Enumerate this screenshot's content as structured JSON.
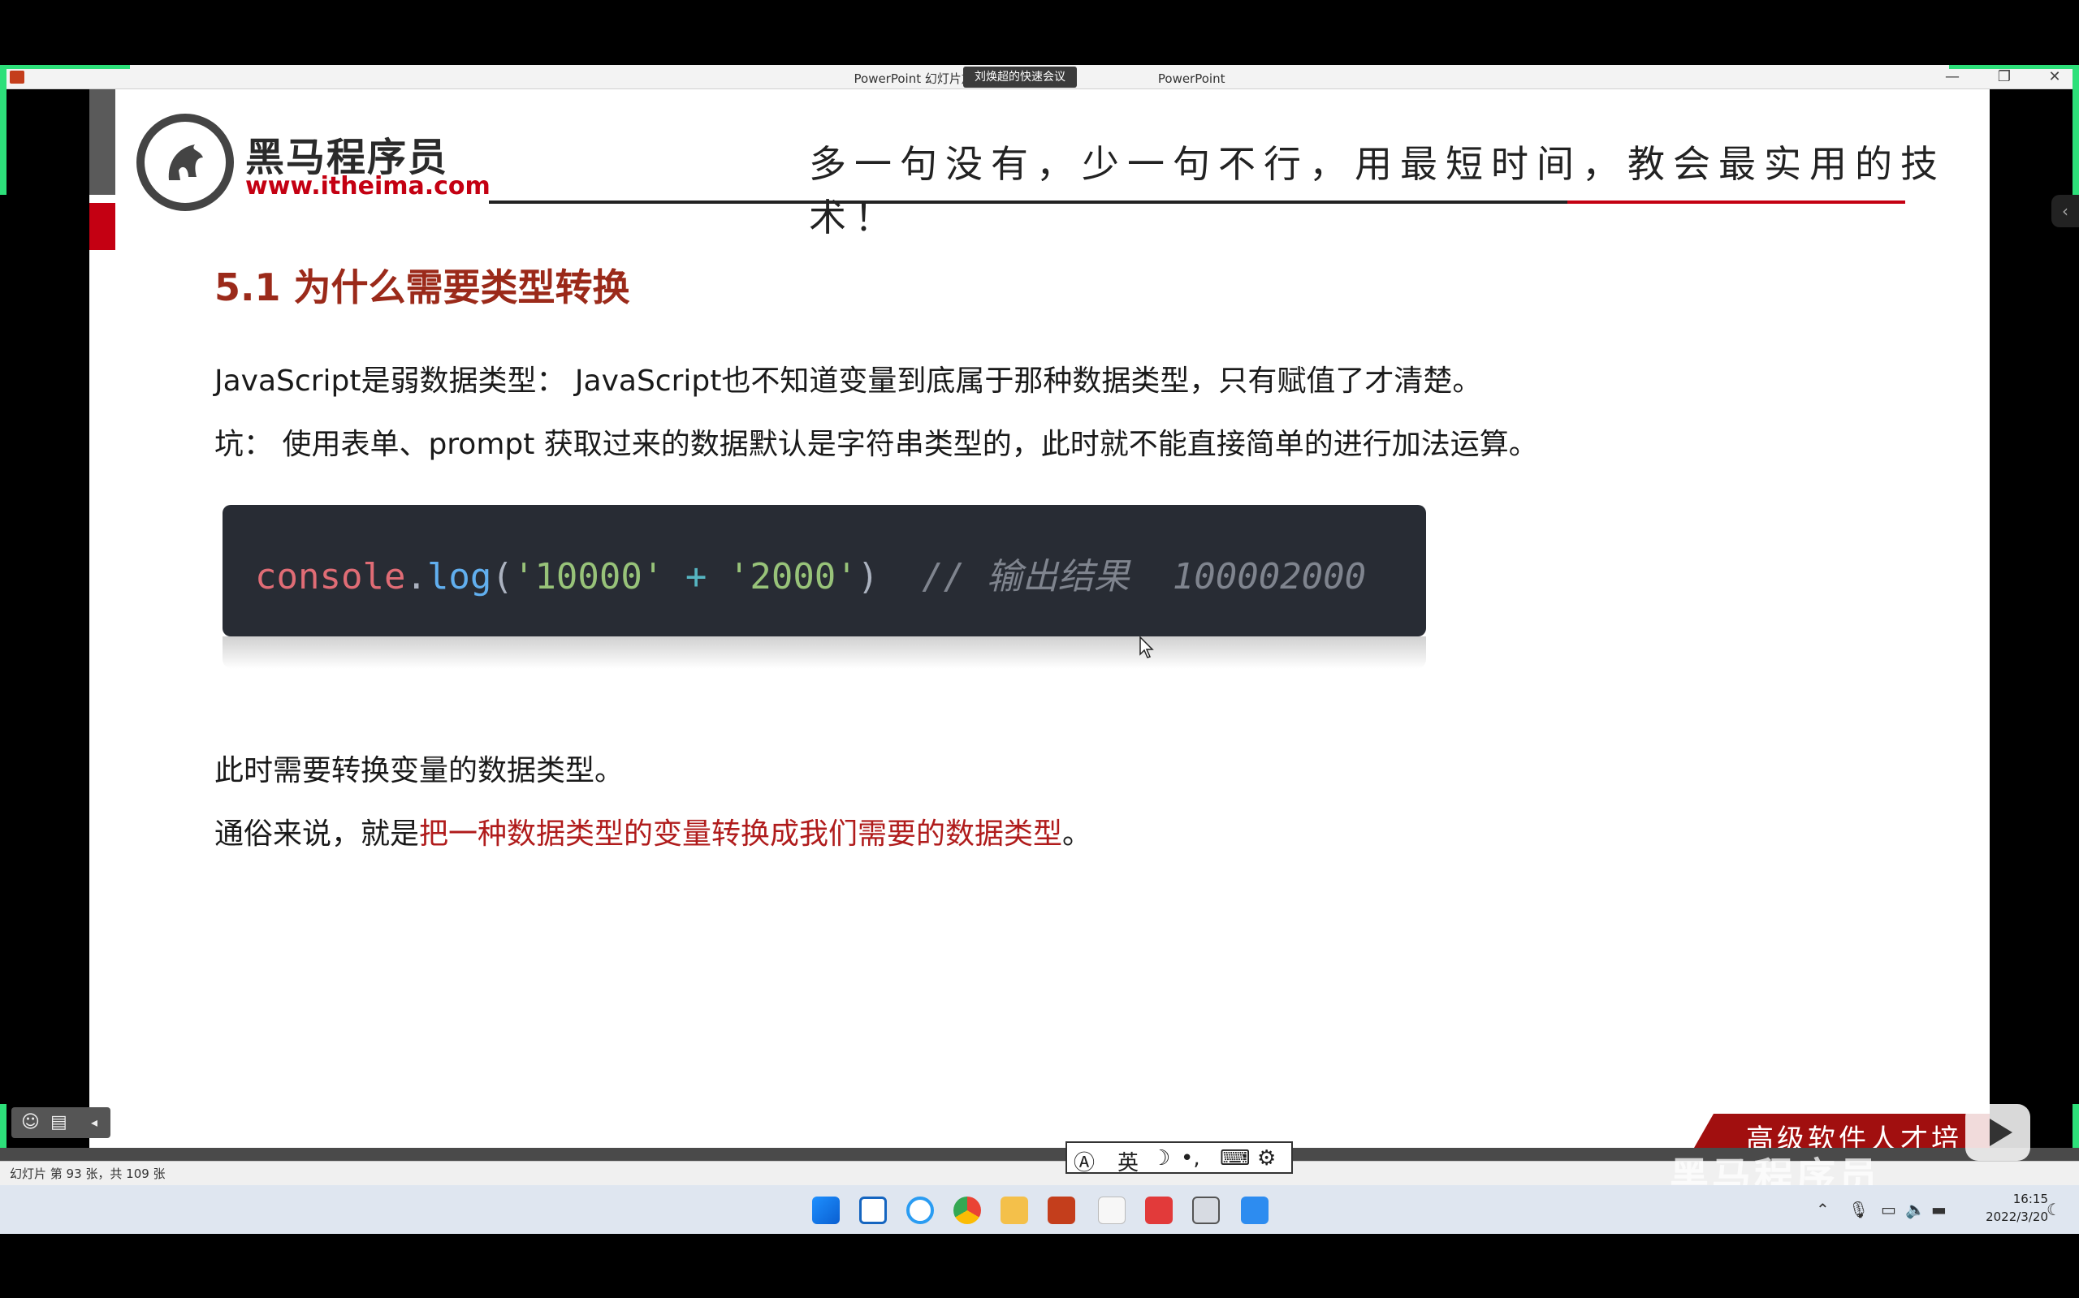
{
  "window": {
    "title": "PowerPoint 幻灯片放映 - [JavaS",
    "meeting_tag": "刘焕超的快速会议",
    "title_suffix": "PowerPoint",
    "minimize": "—",
    "restore": "❐",
    "close": "✕"
  },
  "slide": {
    "logo_name": "黑马程序员",
    "logo_url": "www.itheima.com",
    "slogan": "多一句没有，少一句不行，用最短时间，教会最实用的技术！",
    "heading": "5.1 为什么需要类型转换",
    "para1": "JavaScript是弱数据类型： JavaScript也不知道变量到底属于那种数据类型，只有赋值了才清楚。",
    "para2": "坑： 使用表单、prompt 获取过来的数据默认是字符串类型的，此时就不能直接简单的进行加法运算。",
    "code": {
      "obj": "console",
      "dot": ".",
      "fn": "log",
      "open": "(",
      "str1": "'10000'",
      "op": " + ",
      "str2": "'2000'",
      "close": ")",
      "comment": "  // 输出结果  100002000"
    },
    "para3": "此时需要转换变量的数据类型。",
    "para4_prefix": "通俗来说，就是",
    "para4_highlight": "把一种数据类型的变量转换成我们需要的数据类型",
    "para4_suffix": "。",
    "banner": "高级软件人才培训专家",
    "watermark": "黑马程序员"
  },
  "statusbar": {
    "slide_count": "幻灯片 第 93 张，共 109 张"
  },
  "ime": {
    "lang": "英",
    "moon": "☽",
    "punct": "•,",
    "keyboard": "⌨",
    "settings": "⚙"
  },
  "taskbar": {
    "time": "16:15",
    "date": "2022/3/20"
  },
  "colors": {
    "accent_red": "#c40012",
    "heading": "#9b2a1a",
    "code_bg": "#282c34"
  }
}
